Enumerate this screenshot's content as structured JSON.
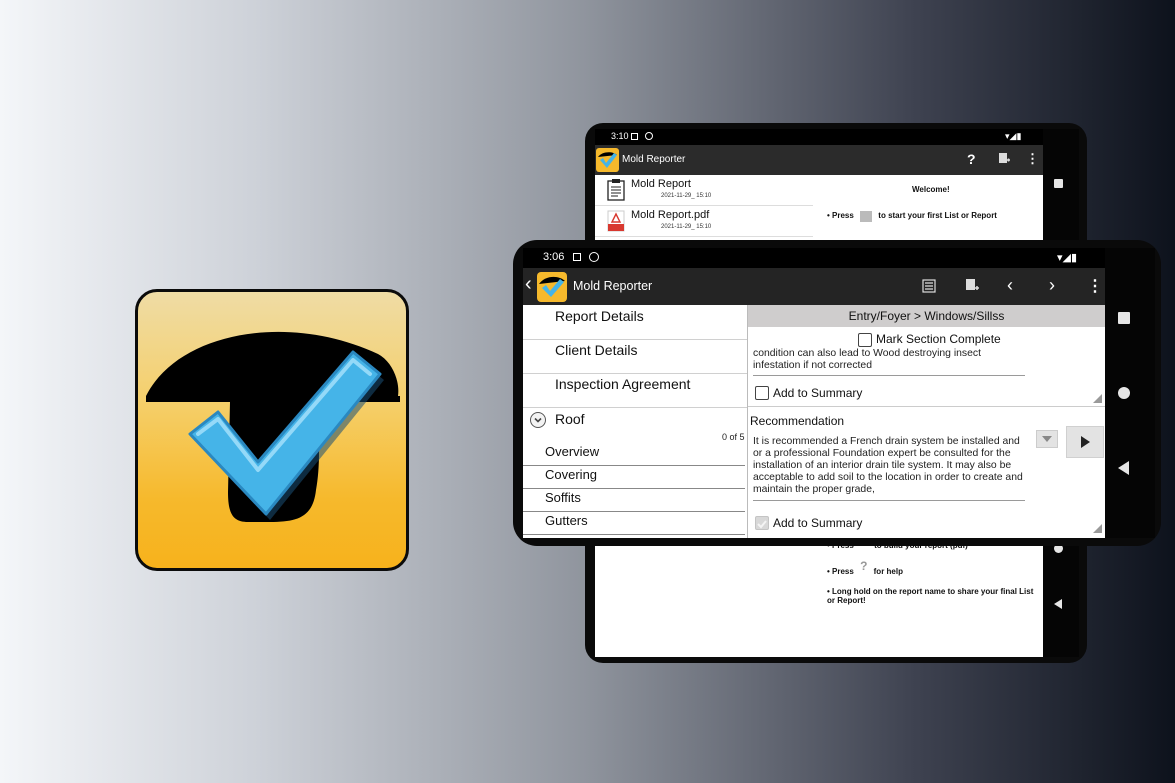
{
  "back_phone": {
    "status": {
      "time": "3:10"
    },
    "toolbar": {
      "title": "Mold Reporter",
      "help_glyph": "?",
      "icons": [
        "help-icon",
        "new-report-icon",
        "overflow-menu-icon"
      ]
    },
    "files": [
      {
        "name": "Mold Report",
        "date": "2021-11-29_ 15:10",
        "icon": "report-clipboard-icon"
      },
      {
        "name": "Mold Report.pdf",
        "date": "2021-11-29_ 15:10",
        "icon": "pdf-file-icon"
      }
    ],
    "welcome": {
      "title": "Welcome!",
      "tip1_pre": "Press",
      "tip1_post": "to start your first List or Report",
      "tip2_pre": "Press",
      "tip2_post": "to build your report (pdf)",
      "tip3_pre": "Press",
      "tip3_glyph": "?",
      "tip3_post": "for help",
      "tip4": "Long hold on the report name to share your final List or Report!"
    }
  },
  "front_phone": {
    "status": {
      "time": "3:06"
    },
    "toolbar": {
      "title": "Mold Reporter",
      "icons": [
        "back-arrow-icon",
        "build-report-icon",
        "new-report-icon",
        "chevron-left-icon",
        "chevron-right-icon",
        "overflow-menu-icon"
      ]
    },
    "sidebar": {
      "items": [
        "Report Details",
        "Client Details",
        "Inspection Agreement"
      ],
      "section": {
        "label": "Roof",
        "count": "0 of 5"
      },
      "sub_items": [
        "Overview",
        "Covering",
        "Soffits",
        "Gutters"
      ]
    },
    "main": {
      "breadcrumb": "Entry/Foyer > Windows/Sillss",
      "mark_complete": "Mark Section Complete",
      "condition_text": "condition can also lead to Wood destroying insect infestation if not corrected",
      "add_summary_1": "Add to Summary",
      "recommendation_label": "Recommendation",
      "recommendation_text": "It is recommended a French drain system be installed and or a professional Foundation expert be consulted for the installation of an interior drain tile system. It may also be acceptable to add soil to the location in order to create and maintain the proper grade,",
      "add_summary_2": "Add to Summary",
      "add_summary_2_checked": true,
      "add_summary_1_checked": false,
      "mark_complete_checked": false
    }
  },
  "colors": {
    "accent_check": "#45b4e8",
    "icon_gold": "#f6b92c",
    "toolbar_dark": "#242424",
    "breadcrumb_bg": "#cfcdcd"
  }
}
